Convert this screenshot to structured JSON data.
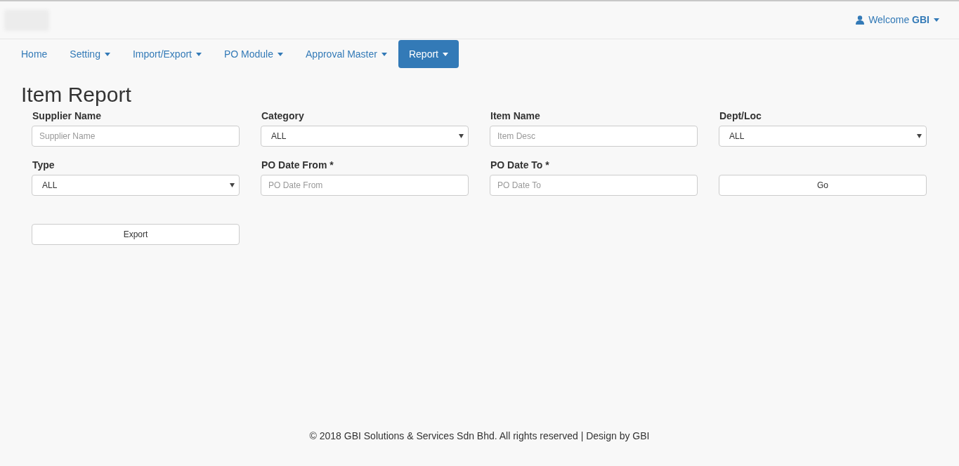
{
  "header": {
    "welcome": "Welcome **GBI**"
  },
  "nav": [
    {
      "label": "Home",
      "dropdown": false,
      "selected": false
    },
    {
      "label": "Setting",
      "dropdown": true,
      "selected": false
    },
    {
      "label": "Import/Export",
      "dropdown": true,
      "selected": false
    },
    {
      "label": "PO Module",
      "dropdown": true,
      "selected": false
    },
    {
      "label": "Approval Master",
      "dropdown": true,
      "selected": false
    },
    {
      "label": "Report",
      "dropdown": true,
      "selected": true
    }
  ],
  "title": "Item Report",
  "fields": [
    {
      "kind": "text",
      "label": "Supplier Name",
      "placeholder": "Supplier Name"
    },
    {
      "kind": "select",
      "label": "Category",
      "value": "ALL"
    },
    {
      "kind": "text",
      "label": "Item Name",
      "placeholder": "Item Desc"
    },
    {
      "kind": "select",
      "label": "Dept/Loc",
      "value": "ALL"
    },
    {
      "kind": "select",
      "label": "Type",
      "value": "ALL"
    },
    {
      "kind": "text",
      "label": "PO Date From *",
      "placeholder": "PO Date From"
    },
    {
      "kind": "text",
      "label": "PO Date To *",
      "placeholder": "PO Date To"
    },
    {
      "kind": "button",
      "label": "Go"
    },
    {
      "kind": "button",
      "label": "Export"
    }
  ],
  "footer": "© 2018 GBI Solutions & Services Sdn Bhd. All rights reserved | Design by GBI"
}
